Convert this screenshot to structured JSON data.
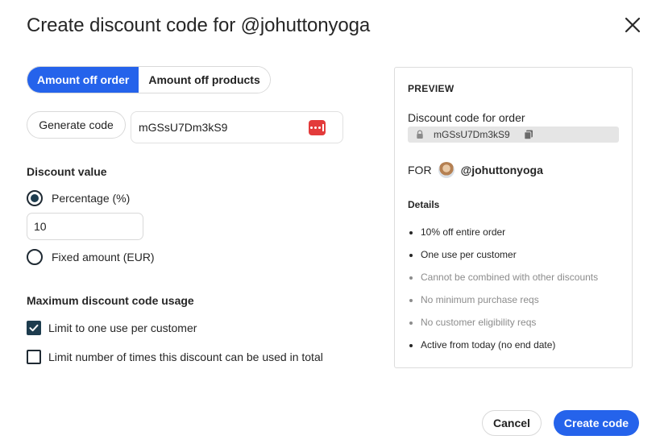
{
  "dialog": {
    "title": "Create discount code for @johuttonyoga",
    "close_icon": "close-icon"
  },
  "tabs": [
    {
      "label": "Amount off order",
      "active": true
    },
    {
      "label": "Amount off products",
      "active": false
    }
  ],
  "code": {
    "generate_label": "Generate code",
    "value": "mGSsU7Dm3kS9",
    "manager_icon": "password-manager-icon"
  },
  "discount_value": {
    "heading": "Discount value",
    "percentage_label": "Percentage (%)",
    "percentage_selected": true,
    "percentage_value": "10",
    "fixed_label": "Fixed amount (EUR)",
    "fixed_selected": false
  },
  "usage": {
    "heading": "Maximum discount code usage",
    "one_per_customer_label": "Limit to one use per customer",
    "one_per_customer_checked": true,
    "total_limit_label": "Limit number of times this discount can be used in total",
    "total_limit_checked": false
  },
  "preview": {
    "heading": "PREVIEW",
    "code_for": "Discount code for order",
    "code_chip": "mGSsU7Dm3kS9",
    "for_label": "FOR",
    "handle": "@johuttonyoga",
    "details_heading": "Details",
    "details": [
      {
        "text": "10% off entire order",
        "active": true
      },
      {
        "text": "One use per customer",
        "active": true
      },
      {
        "text": "Cannot be combined with other discounts",
        "active": false
      },
      {
        "text": "No minimum purchase reqs",
        "active": false
      },
      {
        "text": "No customer eligibility reqs",
        "active": false
      },
      {
        "text": "Active from today (no end date)",
        "active": true
      }
    ]
  },
  "footer": {
    "cancel_label": "Cancel",
    "create_label": "Create code"
  },
  "colors": {
    "accent": "#2563eb",
    "check_fill": "#1d3c4e",
    "password_icon": "#e33b3b"
  }
}
